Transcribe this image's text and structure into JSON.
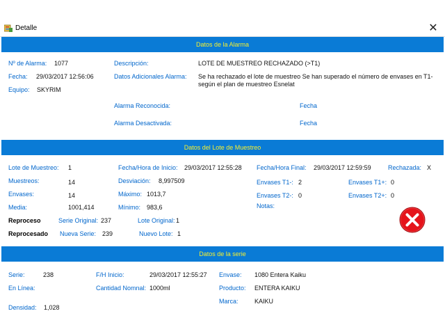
{
  "window": {
    "title": "Detalle",
    "close_glyph": "✕"
  },
  "sections": {
    "alarm": "Datos de la Alarma",
    "lot": "Datos del Lote de Muestreo",
    "series": "Datos de la serie"
  },
  "alarm": {
    "num_label": "Nº de Alarma:",
    "num_value": "1077",
    "date_label": "Fecha:",
    "date_value": "29/03/2017 12:56:06",
    "equipo_label": "Equipo:",
    "equipo_value": "SKYRIM",
    "desc_label": "Descripción:",
    "desc_value": "LOTE DE MUESTREO RECHAZADO (>T1)",
    "extra_label": "Datos Adicionales Alarma:",
    "extra_value": "Se ha rechazado el lote de muestreo Se han superado el número de envases en T1- según el plan de muestreo Esnelat",
    "recognized_label": "Alarma Reconocida:",
    "recognized_date_label": "Fecha",
    "disabled_label": "Alarma Desactivada:",
    "disabled_date_label": "Fecha"
  },
  "lot": {
    "lote_label": "Lote de Muestreo:",
    "lote_value": "1",
    "fh_start_label": "Fecha/Hora de Inicio:",
    "fh_start_value": "29/03/2017 12:55:28",
    "fh_end_label": "Fecha/Hora Final:",
    "fh_end_value": "29/03/2017 12:59:59",
    "rejected_label": "Rechazada:",
    "rejected_value": "X",
    "muestreos_label": "Muestreos:",
    "muestreos_value": "14",
    "desviacion_label": "Desviación:",
    "desviacion_value": "8,997509",
    "t1minus_label": "Envases T1-:",
    "t1minus_value": "2",
    "t1plus_label": "Envases T1+:",
    "t1plus_value": "0",
    "envases_label": "Envases:",
    "envases_value": "14",
    "maximo_label": "Máximo:",
    "maximo_value": "1013,7",
    "t2minus_label": "Envases T2-:",
    "t2minus_value": "0",
    "t2plus_label": "Envases T2+:",
    "t2plus_value": "0",
    "media_label": "Media:",
    "media_value": "1001,414",
    "minimo_label": "Mínimo:",
    "minimo_value": "983,6",
    "notas_label": "Notas:",
    "reproceso_label": "Reproceso",
    "serie_orig_label": "Serie Original:",
    "serie_orig_value": "237",
    "lote_orig_label": "Lote Original:",
    "lote_orig_value": "1",
    "reprocesado_label": "Reprocesado",
    "nueva_serie_label": "Nueva Serie:",
    "nueva_serie_value": "239",
    "nuevo_lote_label": "Nuevo Lote:",
    "nuevo_lote_value": "1",
    "status_icon": "error-icon"
  },
  "series": {
    "serie_label": "Serie:",
    "serie_value": "238",
    "fh_inicio_label": "F/H Inicio:",
    "fh_inicio_value": "29/03/2017 12:55:27",
    "envase_label": "Envase:",
    "envase_value": "1080 Entera Kaiku",
    "en_linea_label": "En Línea:",
    "cantidad_label": "Cantidad Nomnal:",
    "cantidad_value": "1000ml",
    "producto_label": "Producto:",
    "producto_value": "ENTERA KAIKU",
    "marca_label": "Marca:",
    "marca_value": "KAIKU",
    "densidad_label": "Densidad:",
    "densidad_value": "1,028"
  },
  "colors": {
    "header_bg": "#0a7bd6",
    "header_text": "#f7ef2e",
    "label": "#0066cc",
    "error": "#e5141b"
  }
}
